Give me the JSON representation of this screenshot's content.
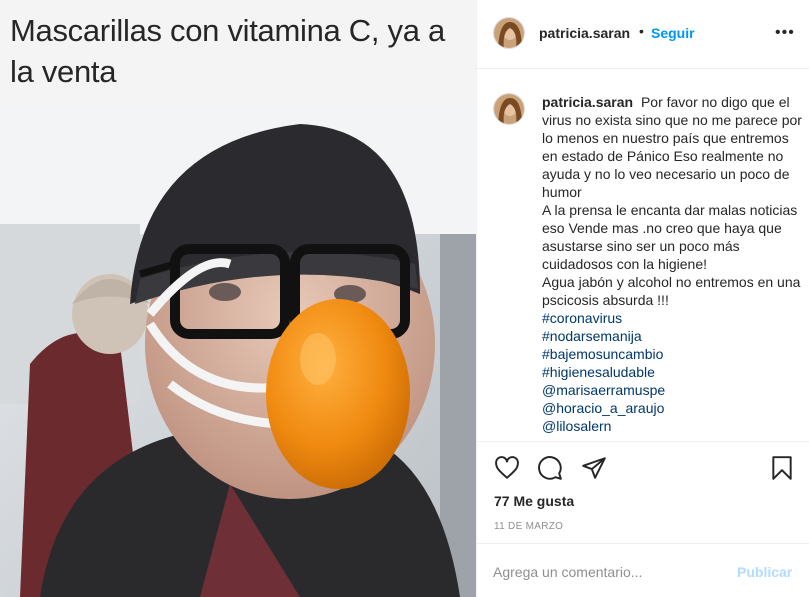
{
  "post_image": {
    "caption_text": "Mascarillas con vitamina C, ya a la venta"
  },
  "header": {
    "username": "patricia.saran",
    "separator": "•",
    "follow_label": "Seguir",
    "more_label": "•••"
  },
  "comment": {
    "username": "patricia.saran",
    "text": "Por favor no digo que el virus no exista sino que no me parece por lo menos en nuestro país que entremos en estado de Pánico Eso realmente no ayuda y no lo veo necesario un poco de humor",
    "text2": "A la prensa le encanta dar malas noticias eso Vende mas .no creo que haya que asustarse sino ser un poco más cuidadosos con la higiene!",
    "text3": "Agua jabón y alcohol no entremos en una pscicosis absurda !!!",
    "tags": [
      "#coronavirus",
      "#nodarsemanija",
      "#bajemosuncambio",
      "#higienesaludable",
      "@marisaerramuspe",
      "@horacio_a_araujo",
      "@lilosalern"
    ]
  },
  "actions": {
    "icons": [
      "heart-icon",
      "comment-icon",
      "share-icon",
      "bookmark-icon"
    ],
    "likes": "77 Me gusta",
    "date": "11 DE MARZO"
  },
  "add_comment": {
    "placeholder": "Agrega un comentario...",
    "publish_label": "Publicar"
  },
  "colors": {
    "link": "#0095f6",
    "hashtag": "#00376b",
    "muted": "#8e8e8e",
    "publish_disabled": "#b3dbff"
  }
}
